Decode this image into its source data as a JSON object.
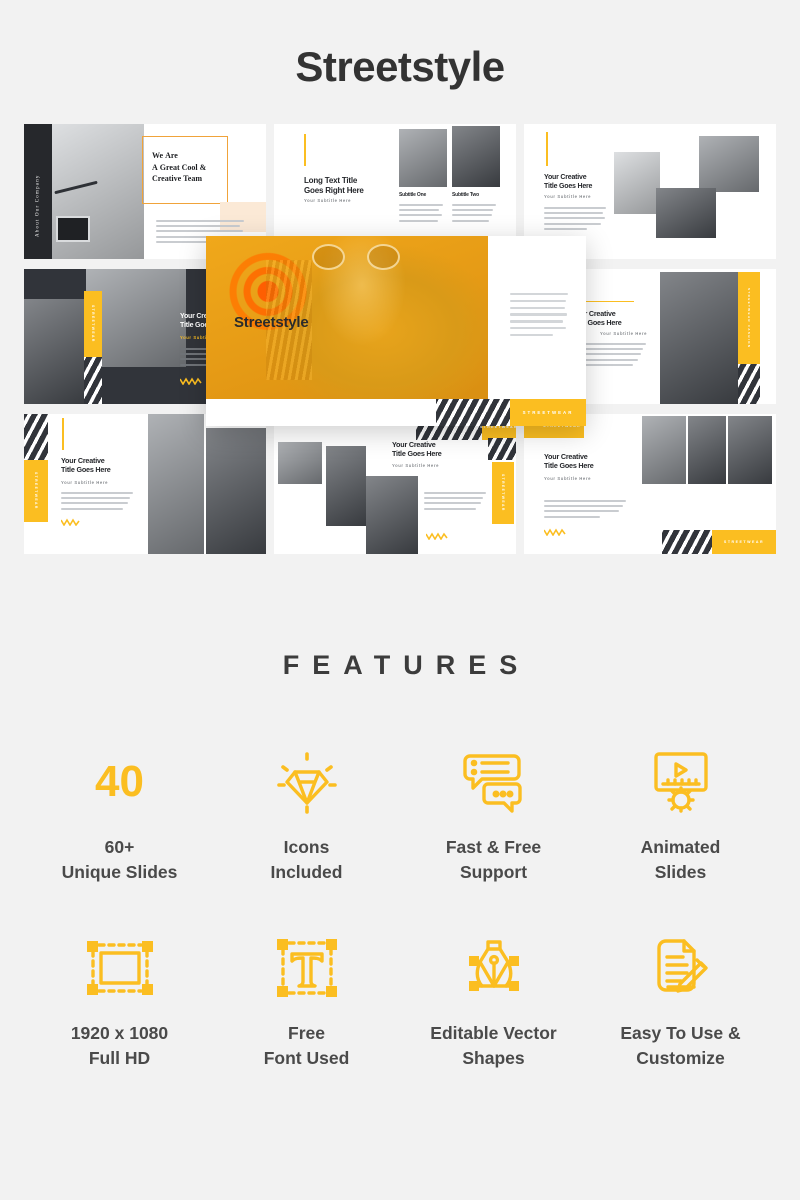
{
  "hero": {
    "title": "Streetstyle"
  },
  "featured_slide": {
    "title": "Streetstyle",
    "badge": "STREETWEAR",
    "body_lines": 7
  },
  "slides": [
    {
      "id": "about-our-company",
      "vertical_label": "About Our Company",
      "title": "We Are\nA Great Cool &\nCreative Team"
    },
    {
      "id": "long-text-title",
      "title": "Long Text Title\nGoes Right Here",
      "subtitle": "Your Subtitle Here",
      "caption_one": "Subtitle One",
      "caption_two": "Subtitle Two"
    },
    {
      "id": "creative-title-collage",
      "title": "Your Creative\nTitle Goes Here",
      "subtitle": "Your Subtitle Here"
    },
    {
      "id": "dark-streetwear",
      "title": "Your Creative\nTitle Goes Here",
      "subtitle": "Your Subtitle Here",
      "vertical_label": "STREETWEAR"
    },
    {
      "id": "creative-photo-right",
      "title": "Your Creative\nTitle Goes Here",
      "subtitle": "Your Subtitle Here",
      "vertical_label": "STREETWEAR FASHION"
    },
    {
      "id": "creative-skate",
      "title": "Your Creative\nTitle Goes Here",
      "subtitle": "Your Subtitle Here",
      "vertical_label": "STREETWEAR"
    },
    {
      "id": "creative-center",
      "title": "Your Creative\nTitle Goes Here",
      "subtitle": "Your Subtitle Here",
      "vertical_label": "STREETWEAR"
    },
    {
      "id": "creative-three-photos",
      "title": "Your Creative\nTitle Goes Here",
      "subtitle": "Your Subtitle Here",
      "badge": "STREETWEAR"
    }
  ],
  "features_section": {
    "heading": "FEATURES",
    "items": [
      {
        "icon": "number-40-icon",
        "value": "40",
        "label": "60+\nUnique Slides"
      },
      {
        "icon": "diamond-icon",
        "value": "",
        "label": "Icons\nIncluded"
      },
      {
        "icon": "chat-bubbles-icon",
        "value": "",
        "label": "Fast & Free\nSupport"
      },
      {
        "icon": "animated-screen-gear-icon",
        "value": "",
        "label": "Animated\nSlides"
      },
      {
        "icon": "selection-frame-icon",
        "value": "",
        "label": "1920 x 1080\nFull HD"
      },
      {
        "icon": "text-tool-icon",
        "value": "",
        "label": "Free\nFont Used"
      },
      {
        "icon": "pen-tool-icon",
        "value": "",
        "label": "Editable Vector\nShapes"
      },
      {
        "icon": "document-pencil-icon",
        "value": "",
        "label": "Easy To Use &\nCustomize"
      }
    ]
  },
  "colors": {
    "accent_yellow": "#fbbe21",
    "dark": "#31343a",
    "background": "#f2f2f2",
    "text": "#3d3d3d"
  }
}
